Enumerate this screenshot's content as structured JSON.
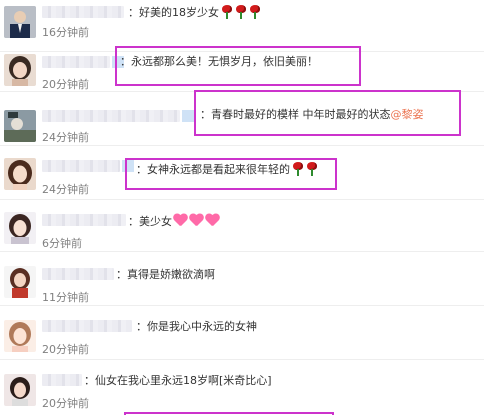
{
  "comments": [
    {
      "text": "：好美的18岁少女",
      "time": "16分钟前",
      "emoji": [
        "rose",
        "rose",
        "rose"
      ]
    },
    {
      "text": "：永远都那么美！无惧岁月，依旧美丽！",
      "time": "20分钟前"
    },
    {
      "text": "：青春时最好的模样 中年时最好的状态",
      "mention": "@黎姿",
      "time": "24分钟前"
    },
    {
      "text": "：女神永远都是看起来很年轻的",
      "time": "24分钟前",
      "emoji": [
        "rose",
        "rose"
      ]
    },
    {
      "text": "：美少女",
      "time": "6分钟前",
      "emoji": [
        "heart",
        "heart",
        "heart"
      ]
    },
    {
      "text": "：真得是娇嫩欲滴啊",
      "time": "11分钟前"
    },
    {
      "text": "：你是我心中永远的女神",
      "time": "20分钟前"
    },
    {
      "text": "：仙女在我心里永远18岁啊[米奇比心]",
      "time": "20分钟前"
    }
  ],
  "highlight_color": "#cc33cc",
  "mention_color": "#eb7350"
}
